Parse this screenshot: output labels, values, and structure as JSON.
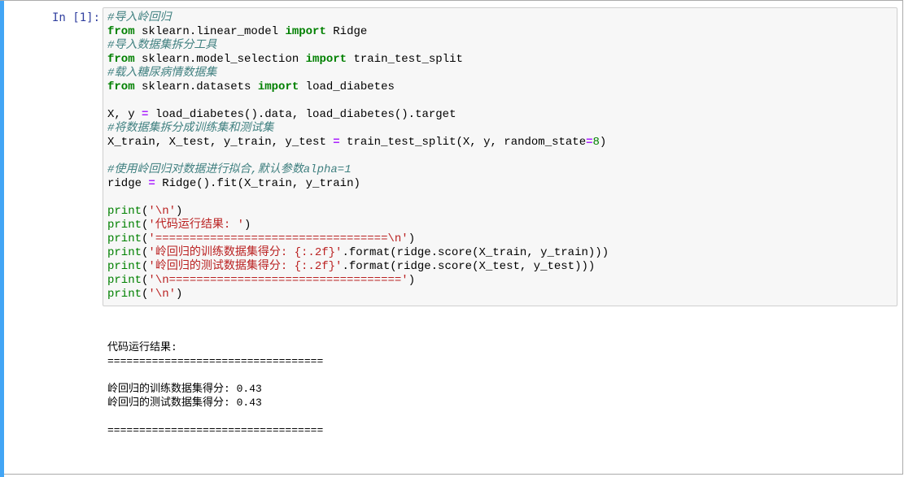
{
  "cell": {
    "prompt": "In [1]:",
    "colors": {
      "selection_bar": "#42a5f5",
      "prompt": "#303f9f",
      "comment": "#408080",
      "keyword": "#008000",
      "string": "#ba2121",
      "operator": "#aa22ff",
      "input_background": "#f7f7f7"
    },
    "code_lines": [
      [
        {
          "t": "#导入岭回归",
          "c": "comment"
        }
      ],
      [
        {
          "t": "from",
          "c": "keyword"
        },
        {
          "t": " sklearn.linear_model "
        },
        {
          "t": "import",
          "c": "keyword"
        },
        {
          "t": " Ridge"
        }
      ],
      [
        {
          "t": "#导入数据集拆分工具",
          "c": "comment"
        }
      ],
      [
        {
          "t": "from",
          "c": "keyword"
        },
        {
          "t": " sklearn.model_selection "
        },
        {
          "t": "import",
          "c": "keyword"
        },
        {
          "t": " train_test_split"
        }
      ],
      [
        {
          "t": "#载入糖尿病情数据集",
          "c": "comment"
        }
      ],
      [
        {
          "t": "from",
          "c": "keyword"
        },
        {
          "t": " sklearn.datasets "
        },
        {
          "t": "import",
          "c": "keyword"
        },
        {
          "t": " load_diabetes"
        }
      ],
      [],
      [
        {
          "t": "X, y "
        },
        {
          "t": "=",
          "c": "operator"
        },
        {
          "t": " load_diabetes().data, load_diabetes().target"
        }
      ],
      [
        {
          "t": "#将数据集拆分成训练集和测试集",
          "c": "comment"
        }
      ],
      [
        {
          "t": "X_train, X_test, y_train, y_test "
        },
        {
          "t": "=",
          "c": "operator"
        },
        {
          "t": " train_test_split(X, y, random_state"
        },
        {
          "t": "=",
          "c": "operator"
        },
        {
          "t": "8",
          "c": "number"
        },
        {
          "t": ")"
        }
      ],
      [],
      [
        {
          "t": "#使用岭回归对数据进行拟合,默认参数alpha=1",
          "c": "comment"
        }
      ],
      [
        {
          "t": "ridge "
        },
        {
          "t": "=",
          "c": "operator"
        },
        {
          "t": " Ridge().fit(X_train, y_train)"
        }
      ],
      [],
      [
        {
          "t": "print",
          "c": "builtin"
        },
        {
          "t": "("
        },
        {
          "t": "'\\n'",
          "c": "string"
        },
        {
          "t": ")"
        }
      ],
      [
        {
          "t": "print",
          "c": "builtin"
        },
        {
          "t": "("
        },
        {
          "t": "'代码运行结果: '",
          "c": "string"
        },
        {
          "t": ")"
        }
      ],
      [
        {
          "t": "print",
          "c": "builtin"
        },
        {
          "t": "("
        },
        {
          "t": "'==================================\\n'",
          "c": "string"
        },
        {
          "t": ")"
        }
      ],
      [
        {
          "t": "print",
          "c": "builtin"
        },
        {
          "t": "("
        },
        {
          "t": "'岭回归的训练数据集得分: {:.2f}'",
          "c": "string"
        },
        {
          "t": ".format(ridge.score(X_train, y_train)))"
        }
      ],
      [
        {
          "t": "print",
          "c": "builtin"
        },
        {
          "t": "("
        },
        {
          "t": "'岭回归的测试数据集得分: {:.2f}'",
          "c": "string"
        },
        {
          "t": ".format(ridge.score(X_test, y_test)))"
        }
      ],
      [
        {
          "t": "print",
          "c": "builtin"
        },
        {
          "t": "("
        },
        {
          "t": "'\\n=================================='",
          "c": "string"
        },
        {
          "t": ")"
        }
      ],
      [
        {
          "t": "print",
          "c": "builtin"
        },
        {
          "t": "("
        },
        {
          "t": "'\\n'",
          "c": "string"
        },
        {
          "t": ")"
        }
      ]
    ],
    "output_lines": [
      "代码运行结果:",
      "==================================",
      "",
      "岭回归的训练数据集得分: 0.43",
      "岭回归的测试数据集得分: 0.43",
      "",
      "=================================="
    ]
  }
}
